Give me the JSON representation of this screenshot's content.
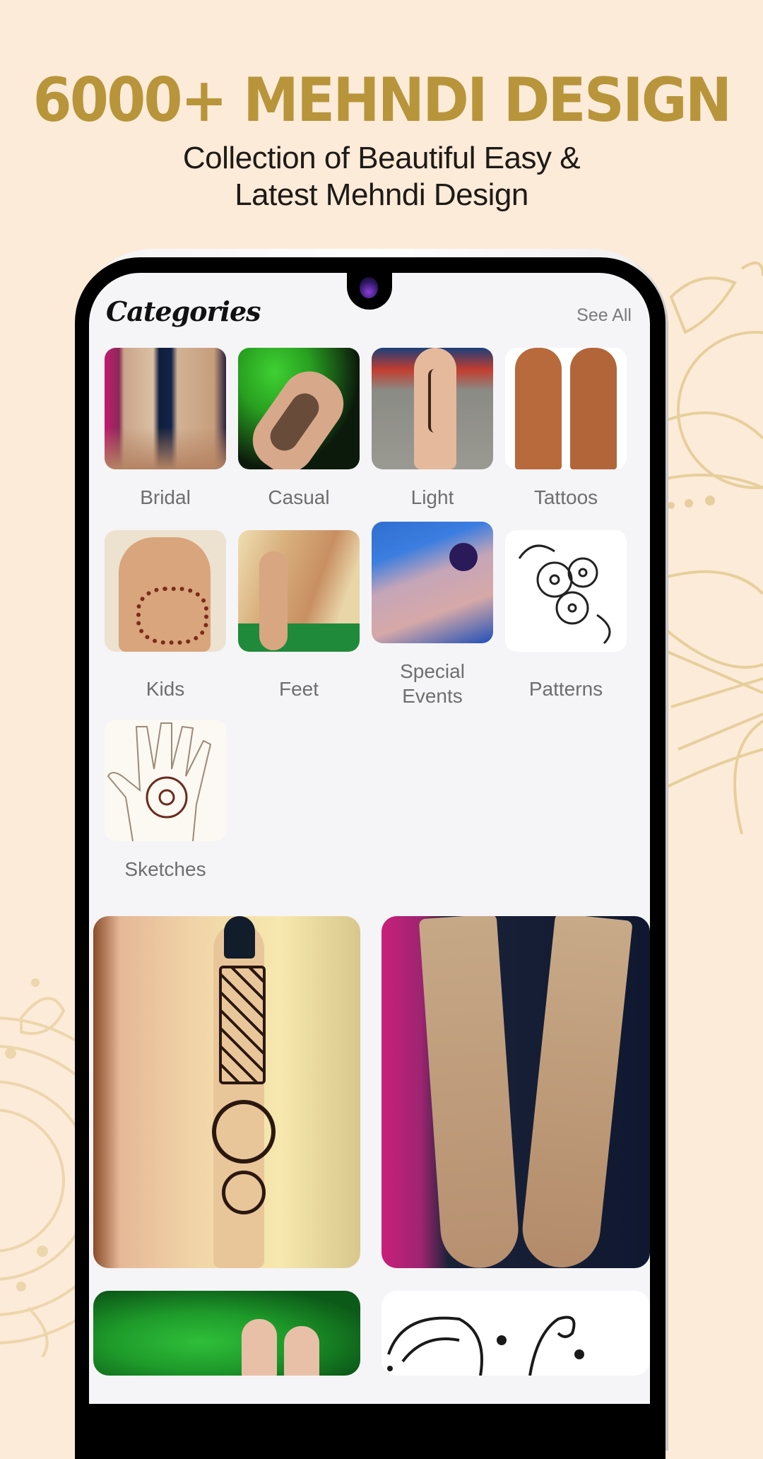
{
  "promo": {
    "headline": "6000+ MEHNDI DESIGN",
    "subtitle_line1": "Collection of Beautiful Easy &",
    "subtitle_line2": "Latest Mehndi Design",
    "accent_color": "#b8953a",
    "background_color": "#fdebd9"
  },
  "app": {
    "section_title": "Categories",
    "see_all_label": "See All",
    "categories": [
      {
        "label": "Bridal",
        "icon": "bridal-hands-image"
      },
      {
        "label": "Casual",
        "icon": "casual-hand-image"
      },
      {
        "label": "Light",
        "icon": "light-arm-image"
      },
      {
        "label": "Tattoos",
        "icon": "tattoo-hands-image"
      },
      {
        "label": "Kids",
        "icon": "kids-hand-image"
      },
      {
        "label": "Feet",
        "icon": "feet-image"
      },
      {
        "label": "Special Events",
        "icon": "special-events-image"
      },
      {
        "label": "Patterns",
        "icon": "pattern-image"
      },
      {
        "label": "Sketches",
        "icon": "sketch-hand-image"
      }
    ],
    "feed": [
      {
        "name": "finger-mehndi-design"
      },
      {
        "name": "bridal-arms-design"
      },
      {
        "name": "green-leaves-hand-design"
      },
      {
        "name": "paisley-pattern-design"
      }
    ]
  }
}
